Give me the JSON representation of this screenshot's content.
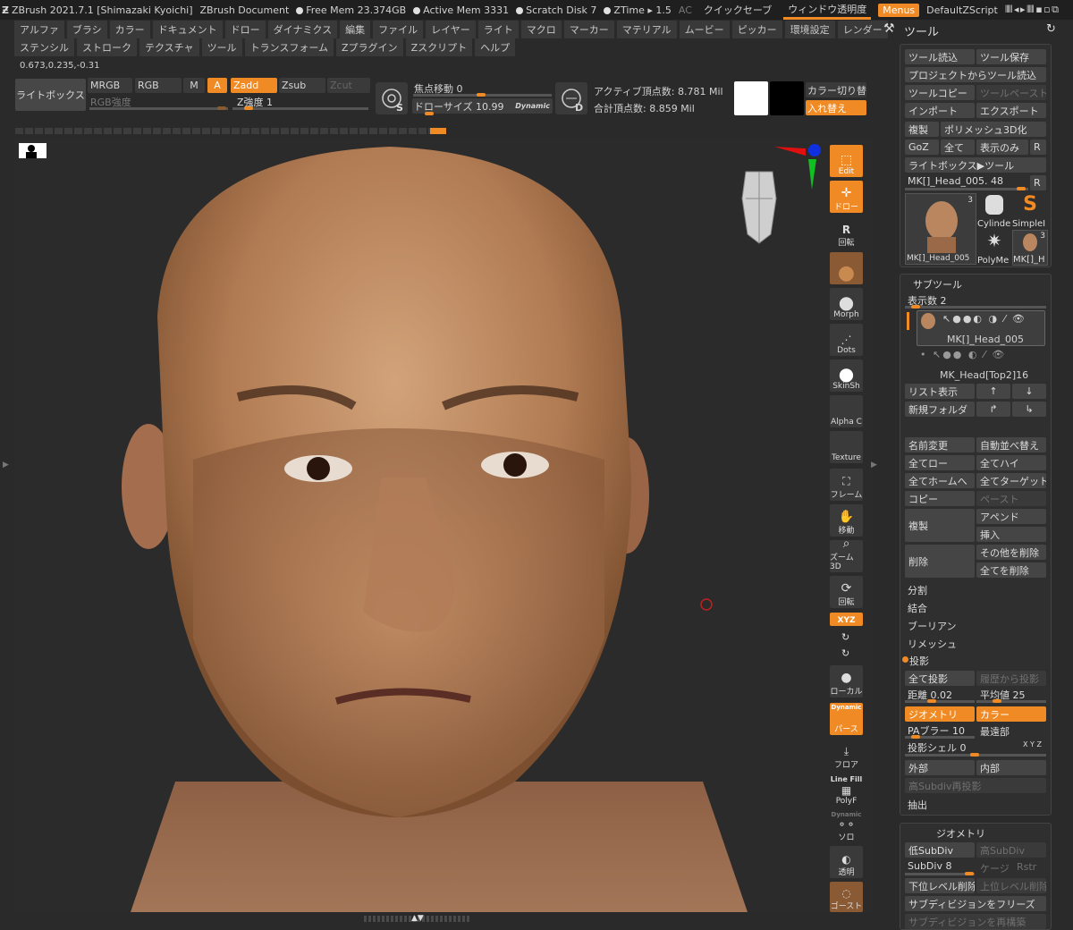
{
  "titlebar": {
    "app": "ZBrush 2021.7.1 [Shimazaki Kyoichi]",
    "doc": "ZBrush Document",
    "free_mem": "Free Mem 23.374GB",
    "active_mem": "Active Mem 3331",
    "scratch": "Scratch Disk 7",
    "ztime": "ZTime ▸ 1.5",
    "ac": "AC",
    "quicksave": "クイックセーブ",
    "transparency": "ウィンドウ透明度",
    "menus": "Menus",
    "script": "DefaultZScript"
  },
  "menus_row1": [
    "アルファ",
    "ブラシ",
    "カラー",
    "ドキュメント",
    "ドロー",
    "ダイナミクス",
    "編集",
    "ファイル",
    "レイヤー",
    "ライト",
    "マクロ",
    "マーカー",
    "マテリアル",
    "ムービー",
    "ピッカー",
    "環境設定",
    "レンダー"
  ],
  "menus_row2": [
    "ステンシル",
    "ストローク",
    "テクスチャ",
    "ツール",
    "トランスフォーム",
    "Zプラグイン",
    "Zスクリプト",
    "ヘルプ"
  ],
  "coords": "0.673,0.235,-0.31",
  "toolbar": {
    "lightbox": "ライトボックス",
    "mrgb": "MRGB",
    "rgb": "RGB",
    "m": "M",
    "a": "A",
    "zadd": "Zadd",
    "zsub": "Zsub",
    "zcut": "Zcut",
    "rgb_intensity": "RGB強度",
    "z_intensity": "Z強度 1",
    "s": "S",
    "focal_shift": "焦点移動 0",
    "draw_size": "ドローサイズ 10.99",
    "dynamic": "Dynamic",
    "d": "D",
    "active_points": "アクティブ頂点数: 8.781 Mil",
    "total_points": "合計頂点数: 8.859 Mil",
    "color_switch": "カラー切り替",
    "swap": "入れ替え"
  },
  "right_toolbar": {
    "edit": "Edit",
    "draw": "ドロー",
    "rotate": "回転",
    "morph": "Morph",
    "dots": "Dots",
    "skinsh": "SkinSh",
    "alpha": "Alpha C",
    "texture": "Texture",
    "frame": "フレーム",
    "move": "移動",
    "zoom": "ズーム3D",
    "rotate2": "回転",
    "xyz": "XYZ",
    "local": "ローカル",
    "dynamic": "Dynamic",
    "persp": "パース",
    "floor": "フロア",
    "line_fill": "Line Fill",
    "polyf": "PolyF",
    "dynamic2": "Dynamic",
    "solo": "ソロ",
    "transp": "透明",
    "ghost": "ゴースト"
  },
  "tool_panel": {
    "title": "ツール",
    "load": "ツール読込",
    "save": "ツール保存",
    "load_project": "プロジェクトからツール読込",
    "copy": "ツールコピー",
    "paste": "ツールペースト",
    "import": "インポート",
    "export": "エクスポート",
    "clone": "複製",
    "polymesh": "ポリメッシュ3D化",
    "goz": "GoZ",
    "all": "全て",
    "visible": "表示のみ",
    "r": "R",
    "lightbox_tool": "ライトボックス▶ツール",
    "current": "MK[]_Head_005. 48",
    "thumbs": [
      {
        "name": "MK[]_Head_005",
        "count": "3"
      },
      {
        "name": "Cylinde"
      },
      {
        "name": "SimpleI"
      },
      {
        "name": "PolyMe"
      },
      {
        "name": "MK[]_H",
        "count": "3"
      }
    ]
  },
  "subtool": {
    "title": "サブツール",
    "display": "表示数 2",
    "item1": "MK[]_Head_005",
    "item2": "MK_Head[Top2]16",
    "list": "リスト表示",
    "new_folder": "新規フォルダ",
    "rename": "名前変更",
    "autoreorder": "自動並べ替え",
    "all_low": "全てロー",
    "all_high": "全てハイ",
    "all_home": "全てホームへ",
    "all_target": "全てターゲット",
    "copy": "コピー",
    "paste": "ペースト",
    "dup": "複製",
    "append": "アペンド",
    "insert": "挿入",
    "delete": "削除",
    "del_other": "その他を削除",
    "del_all": "全てを削除",
    "split": "分割",
    "merge": "結合",
    "boolean": "ブーリアン",
    "remesh": "リメッシュ",
    "project": "投影",
    "project_all": "全て投影",
    "project_history": "履歴から投影",
    "dist": "距離 0.02",
    "mean": "平均値 25",
    "geometry": "ジオメトリ",
    "color": "カラー",
    "pa_blur": "PAブラー 10",
    "farthest": "最遠部",
    "proj_shell": "投影シェル 0",
    "xyz": "X Y Z",
    "outer": "外部",
    "inner": "内部",
    "reproject": "高Subdiv再投影",
    "extract": "抽出"
  },
  "geometry": {
    "title": "ジオメトリ",
    "lower": "低SubDiv",
    "higher": "高SubDiv",
    "sdiv": "SubDiv 8",
    "cage": "ケージ",
    "rstr": "Rstr",
    "del_lower": "下位レベル削除",
    "del_higher": "上位レベル削除",
    "freeze": "サブディビジョンをフリーズ",
    "reconstruct": "サブディビジョンを再構築"
  }
}
